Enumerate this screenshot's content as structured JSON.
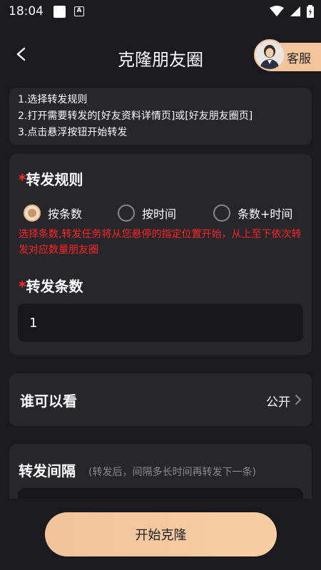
{
  "status_bar": {
    "time": "18:04",
    "a_icon": "A"
  },
  "header": {
    "title": "克隆朋友圈",
    "service_label": "客服"
  },
  "instructions": [
    "1.选择转发规则",
    "2.打开需要转发的[好友资料详情页]或[好友朋友圈页]",
    "3.点击悬浮按钮开始转发"
  ],
  "rules": {
    "required_mark": "*",
    "title": "转发规则",
    "options": [
      "按条数",
      "按时间",
      "条数+时间"
    ],
    "selected_index": 0,
    "hint": "选择条数,转发任务将从您悬停的指定位置开始，从上至下依次转发对应数量朋友圈"
  },
  "count": {
    "required_mark": "*",
    "title": "转发条数",
    "value": "1"
  },
  "visibility": {
    "title": "谁可以看",
    "value": "公开"
  },
  "interval": {
    "title": "转发间隔",
    "hint": "(转发后，间隔多长时间再转发下一条)"
  },
  "start_button": {
    "label": "开始克隆"
  },
  "colors": {
    "accent": "#f3c59a",
    "error": "#ff2323",
    "card": "#26262b",
    "background": "#1b1b1f"
  }
}
